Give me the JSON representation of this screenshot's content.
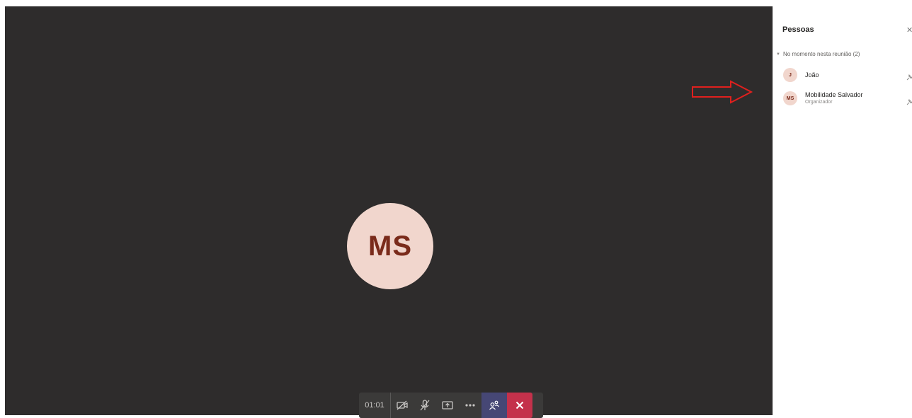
{
  "stage": {
    "avatar_initials": "MS",
    "avatar_bg": "#f1d6cd",
    "avatar_text_color": "#7a2b1b"
  },
  "toolbar": {
    "timer": "01:01",
    "buttons": [
      {
        "name": "camera-off-icon"
      },
      {
        "name": "mic-off-icon"
      },
      {
        "name": "share-screen-icon"
      },
      {
        "name": "more-options-icon"
      },
      {
        "name": "participants-icon"
      },
      {
        "name": "hang-up-icon"
      }
    ],
    "hangup_color": "#c4314b",
    "participants_active_color": "#464775"
  },
  "panel": {
    "title": "Pessoas",
    "close_icon": "close-icon",
    "section_label": "No momento nesta reunião (2)",
    "people": [
      {
        "initials": "J",
        "name": "João",
        "role": ""
      },
      {
        "initials": "MS",
        "name": "Mobilidade Salvador",
        "role": "Organizador"
      }
    ]
  },
  "annotation": {
    "arrow_color": "#e0201e"
  }
}
